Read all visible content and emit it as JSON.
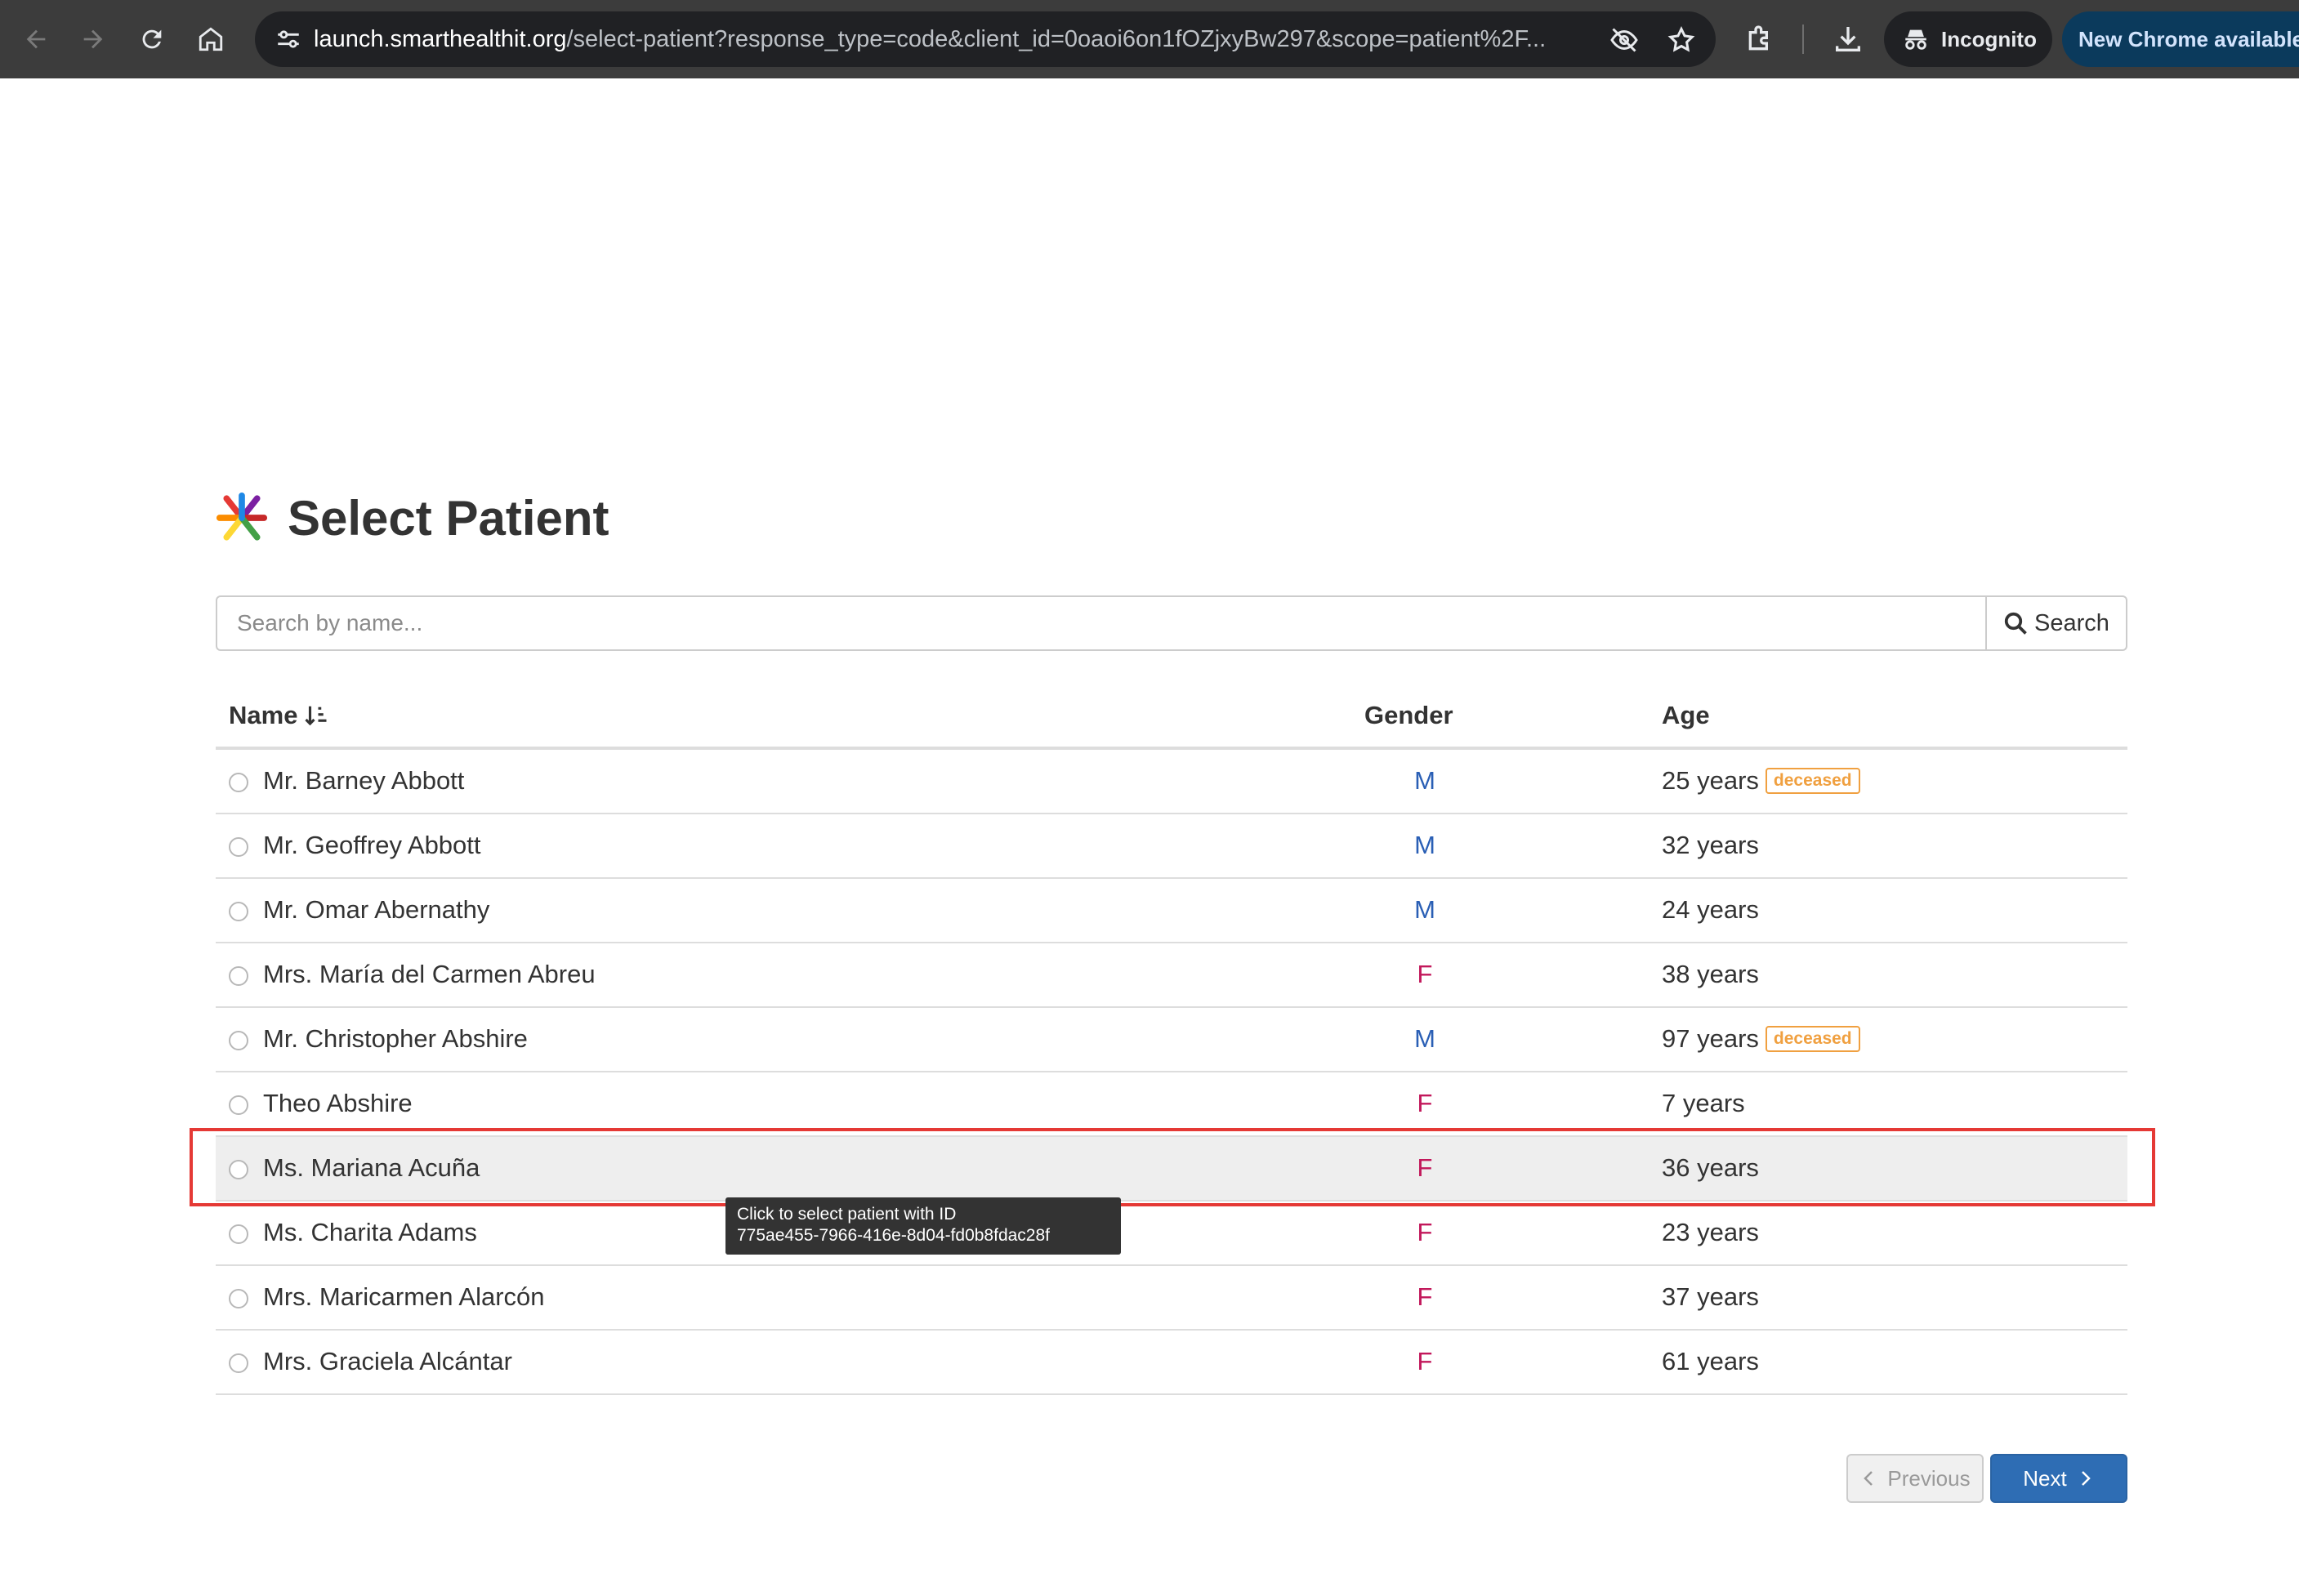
{
  "browser": {
    "url_host": "launch.smarthealthit.org",
    "url_rest": "/select-patient?response_type=code&client_id=0oaoi6on1fOZjxyBw297&scope=patient%2F...",
    "incognito_label": "Incognito",
    "update_label": "New Chrome available"
  },
  "page": {
    "title": "Select Patient"
  },
  "search": {
    "placeholder": "Search by name...",
    "button_label": "Search"
  },
  "table": {
    "headers": {
      "name": "Name",
      "gender": "Gender",
      "age": "Age"
    },
    "rows": [
      {
        "name": "Mr. Barney Abbott",
        "gender": "M",
        "age": "25 years",
        "badge": "deceased"
      },
      {
        "name": "Mr. Geoffrey Abbott",
        "gender": "M",
        "age": "32 years",
        "badge": ""
      },
      {
        "name": "Mr. Omar Abernathy",
        "gender": "M",
        "age": "24 years",
        "badge": ""
      },
      {
        "name": "Mrs. María del Carmen Abreu",
        "gender": "F",
        "age": "38 years",
        "badge": ""
      },
      {
        "name": "Mr. Christopher Abshire",
        "gender": "M",
        "age": "97 years",
        "badge": "deceased"
      },
      {
        "name": "Theo Abshire",
        "gender": "F",
        "age": "7 years",
        "badge": ""
      },
      {
        "name": "Ms. Mariana Acuña",
        "gender": "F",
        "age": "36 years",
        "badge": ""
      },
      {
        "name": "Ms. Charita Adams",
        "gender": "F",
        "age": "23 years",
        "badge": ""
      },
      {
        "name": "Mrs. Maricarmen Alarcón",
        "gender": "F",
        "age": "37 years",
        "badge": ""
      },
      {
        "name": "Mrs. Graciela Alcántar",
        "gender": "F",
        "age": "61 years",
        "badge": ""
      }
    ]
  },
  "tooltip": {
    "line1": "Click to select patient with ID",
    "line2": "775ae455-7966-416e-8d04-fd0b8fdac28f"
  },
  "pagination": {
    "previous_label": "Previous",
    "next_label": "Next"
  },
  "colors": {
    "male": "#2a5fb5",
    "female": "#c2185b",
    "deceased_badge": "#f0a040",
    "next_button": "#2e6db4",
    "selection_outline": "#e53935"
  },
  "icons": [
    "back-arrow-icon",
    "forward-arrow-icon",
    "reload-icon",
    "home-icon",
    "site-settings-icon",
    "eye-off-icon",
    "star-icon",
    "extensions-icon",
    "download-icon",
    "incognito-icon",
    "sort-icon",
    "search-icon",
    "chevron-left-icon",
    "chevron-right-icon"
  ]
}
